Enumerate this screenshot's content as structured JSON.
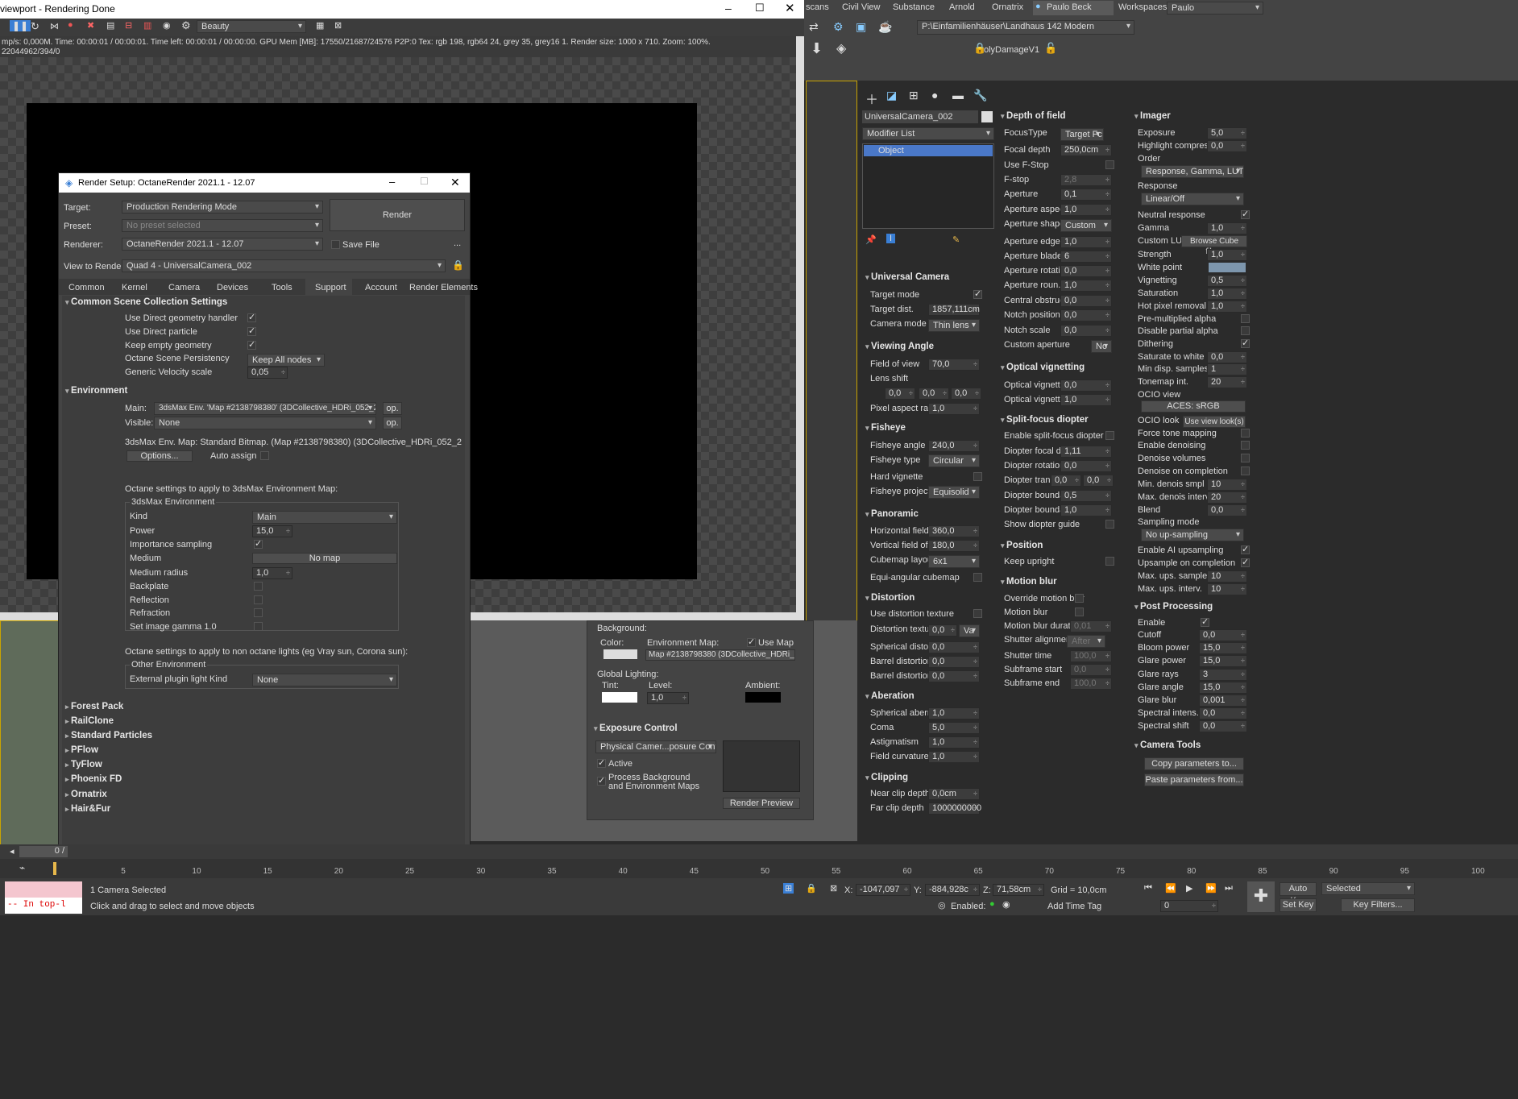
{
  "vfb": {
    "title": "viewport - Rendering Done",
    "channel": "Beauty",
    "status": "mp/s: 0,000M.   Time: 00:00:01 / 00:00:01.   Time left: 00:00:01 / 00:00:00.   GPU Mem [MB]: 17550/21687/24576 P2P:0   Tex: rgb 198, rgb64 24, grey 35, grey16 1.   Render size: 1000 x 710.   Zoom: 100%.",
    "status2": "22044962/394/0"
  },
  "topmenu": {
    "items": [
      "scans",
      "Civil View",
      "Substance",
      "Arnold",
      "Ornatrix"
    ],
    "user": "Paulo Beck",
    "workspaces_label": "Workspaces:",
    "workspace": "Paulo",
    "path": "P:\\Einfamilienhäuser\\Landhaus 142 Modern",
    "objname": "olyDamageV1"
  },
  "rs": {
    "title": "Render Setup: OctaneRender 2021.1 - 12.07",
    "target_label": "Target:",
    "target": "Production Rendering Mode",
    "preset_label": "Preset:",
    "preset": "No preset selected",
    "renderer_label": "Renderer:",
    "renderer": "OctaneRender 2021.1 - 12.07",
    "save_file": "Save File",
    "dots": "...",
    "render_btn": "Render",
    "view_label": "View to Render:",
    "view": "Quad 4 - UniversalCamera_002",
    "tabs": [
      "Common",
      "Kernel",
      "Camera",
      "Devices",
      "Tools",
      "Support",
      "Account",
      "Render Elements"
    ],
    "csc": {
      "title": "Common Scene Collection Settings",
      "rows": [
        "Use Direct geometry handler",
        "Use Direct particle",
        "Keep empty geometry",
        "Octane Scene Persistency",
        "Generic Velocity scale"
      ],
      "persist": "Keep All nodes",
      "velocity": "0,05"
    },
    "env": {
      "title": "Environment",
      "main_label": "Main:",
      "main": "3dsMax Env. 'Map #2138798380' (3DCollective_HDRi_052_2113",
      "visible_label": "Visible:",
      "visible": "None",
      "op": "op.",
      "info": "3dsMax Env. Map:  Standard Bitmap. (Map #2138798380) (3DCollective_HDRi_052_2",
      "options": "Options...",
      "auto": "Auto assign",
      "octane_text": "Octane settings to apply to 3dsMax Environment Map:",
      "group": "3dsMax Environment",
      "rows": [
        "Kind",
        "Power",
        "Importance sampling",
        "Medium",
        "Medium radius",
        "Backplate",
        "Reflection",
        "Refraction",
        "Set image gamma 1.0"
      ],
      "kind": "Main",
      "power": "15,0",
      "medium": "No map",
      "radius": "1,0",
      "nonoct_text": "Octane settings to apply to non octane lights (eg Vray sun, Corona sun):",
      "other_group": "Other Environment",
      "ext_label": "External plugin light Kind",
      "ext": "None"
    },
    "rollouts": [
      "Forest Pack",
      "RailClone",
      "Standard Particles",
      "PFlow",
      "TyFlow",
      "Phoenix FD",
      "Ornatrix",
      "Hair&Fur"
    ]
  },
  "envpanel": {
    "background": "Background:",
    "color": "Color:",
    "envmap": "Environment Map:",
    "usemap": "Use Map",
    "map": "Map #2138798380 (3DCollective_HDRi_052_",
    "global": "Global Lighting:",
    "tint": "Tint:",
    "level": "Level:",
    "level_val": "1,0",
    "ambient": "Ambient:",
    "exposure": "Exposure Control",
    "exp_type": "Physical Camer...posure Control",
    "active": "Active",
    "process": "Process Background",
    "process2": "and Environment Maps",
    "preview": "Render Preview"
  },
  "cmd": {
    "object_name": "UniversalCamera_002",
    "modlist": "Modifier List",
    "stack_item": "Object",
    "uc": {
      "title": "Universal Camera",
      "target_mode": "Target mode",
      "target_dist": "Target dist.",
      "target_dist_v": "1857,111cm",
      "cam_mode": "Camera mode",
      "cam_mode_v": "Thin lens"
    },
    "va": {
      "title": "Viewing Angle",
      "fov": "Field of view",
      "fov_v": "70,0",
      "shift": "Lens shift",
      "s1": "0,0",
      "s2": "0,0",
      "s3": "0,0",
      "par": "Pixel aspect ratio",
      "par_v": "1,0"
    },
    "fish": {
      "title": "Fisheye",
      "angle": "Fisheye angle",
      "angle_v": "240,0",
      "type": "Fisheye type",
      "type_v": "Circular",
      "hard": "Hard vignette",
      "proj": "Fisheye project...",
      "proj_v": "Equisolid"
    },
    "pano": {
      "title": "Panoramic",
      "hf": "Horizontal field ...",
      "hf_v": "360,0",
      "vf": "Vertical field of ...",
      "vf_v": "180,0",
      "cube": "Cubemap layout",
      "cube_v": "6x1",
      "equi": "Equi-angular cubemap"
    },
    "dist": {
      "title": "Distortion",
      "tex": "Use distortion texture",
      "dtex": "Distortion texture",
      "dtex_v": "0,0",
      "dtex_d": "Va",
      "sph": "Spherical distort...",
      "sph_v": "0,0",
      "bar": "Barrel distortion",
      "bar_v": "0,0",
      "bar2": "Barrel distortion...",
      "bar2_v": "0,0"
    },
    "aber": {
      "title": "Aberation",
      "sph": "Spherical aberra...",
      "sph_v": "1,0",
      "coma": "Coma",
      "coma_v": "5,0",
      "ast": "Astigmatism",
      "ast_v": "1,0",
      "fc": "Field curvature",
      "fc_v": "1,0"
    },
    "clip": {
      "title": "Clipping",
      "near": "Near clip depth",
      "near_v": "0,0cm",
      "far": "Far clip depth",
      "far_v": "1000000000"
    }
  },
  "dof": {
    "title": "Depth of field",
    "focus": "FocusType",
    "focus_v": "Target Fc",
    "fdepth": "Focal depth",
    "fdepth_v": "250,0cm",
    "fstop_use": "Use F-Stop",
    "fstop": "F-stop",
    "fstop_v": "2,8",
    "aperture": "Aperture",
    "aperture_v": "0,1",
    "aspect": "Aperture aspect...",
    "aspect_v": "1,0",
    "shape": "Aperture shape",
    "shape_v": "Custom",
    "edge": "Aperture edge",
    "edge_v": "1,0",
    "blade": "Aperture blade...",
    "blade_v": "6",
    "rot": "Aperture rotation",
    "rot_v": "0,0",
    "round": "Aperture roun...",
    "round_v": "1,0",
    "central": "Central obstruc...",
    "central_v": "0,0",
    "notchp": "Notch position",
    "notchp_v": "0,0",
    "notchs": "Notch scale",
    "notchs_v": "0,0",
    "custom": "Custom aperture",
    "custom_v": "No"
  },
  "ov": {
    "title": "Optical vignetting",
    "a": "Optical vignette...",
    "a_v": "0,0",
    "b": "Optical vignette...",
    "b_v": "1,0"
  },
  "sfd": {
    "title": "Split-focus diopter",
    "enable": "Enable split-focus diopter",
    "focal": "Diopter focal d...",
    "focal_v": "1,11",
    "rot": "Diopter rotation",
    "rot_v": "0,0",
    "tran": "Diopter tran...",
    "t1": "0,0",
    "t2": "0,0",
    "b1": "Diopter bounda...",
    "b1_v": "0,5",
    "b2": "Diopter bounda...",
    "b2_v": "1,0",
    "guide": "Show diopter guide"
  },
  "pos": {
    "title": "Position",
    "keep": "Keep upright"
  },
  "mb": {
    "title": "Motion blur",
    "ovr": "Override motion blur",
    "mb": "Motion blur",
    "dur": "Motion blur duration",
    "dur_v": "0,01",
    "shut": "Shutter alignment",
    "shut_v": "After",
    "stime": "Shutter time",
    "stime_v": "100,0",
    "sstart": "Subframe start",
    "sstart_v": "0,0",
    "send": "Subframe end",
    "send_v": "100,0"
  },
  "img": {
    "title": "Imager",
    "exposure": "Exposure",
    "exposure_v": "5,0",
    "hl": "Highlight compres...",
    "hl_v": "0,0",
    "order": "Order",
    "order_v": "Response, Gamma, LUT",
    "resp": "Response",
    "resp_v": "Linear/Off",
    "neutral": "Neutral response",
    "gamma": "Gamma",
    "gamma_v": "1,0",
    "lut": "Custom LUT",
    "lut_v": "Browse Cube file...",
    "strength": "Strength",
    "strength_v": "1,0",
    "wp": "White point",
    "vig": "Vignetting",
    "vig_v": "0,5",
    "sat": "Saturation",
    "sat_v": "1,0",
    "hot": "Hot pixel removal",
    "hot_v": "1,0",
    "prem": "Pre-multiplied alpha",
    "dpa": "Disable partial alpha",
    "dither": "Dithering",
    "stw": "Saturate to white",
    "stw_v": "0,0",
    "mds": "Min disp. samples",
    "mds_v": "1",
    "tmi": "Tonemap int.",
    "tmi_v": "20",
    "ocio": "OCIO view",
    "ocio_v": "ACES: sRGB",
    "ociolook": "OCIO look",
    "ociolook_v": "Use view look(s)",
    "ftm": "Force tone mapping",
    "den": "Enable denoising",
    "dvol": "Denoise volumes",
    "doc": "Denoise on completion",
    "mdsmp": "Min. denois smpl",
    "mdsmp_v": "10",
    "mdi": "Max. denois interv.",
    "mdi_v": "20",
    "blend": "Blend",
    "blend_v": "0,0",
    "smode": "Sampling mode",
    "smode_v": "No up-sampling",
    "ai": "Enable AI upsampling",
    "uoc": "Upsample on completion",
    "mus": "Max. ups. samples",
    "mus_v": "10",
    "mui": "Max. ups. interv.",
    "mui_v": "10"
  },
  "pp": {
    "title": "Post Processing",
    "enable": "Enable",
    "cutoff": "Cutoff",
    "cutoff_v": "0,0",
    "bloom": "Bloom power",
    "bloom_v": "15,0",
    "glare": "Glare power",
    "glare_v": "15,0",
    "rays": "Glare rays",
    "rays_v": "3",
    "gangle": "Glare angle",
    "gangle_v": "15,0",
    "gblur": "Glare blur",
    "gblur_v": "0,001",
    "si": "Spectral intens.",
    "si_v": "0,0",
    "ss": "Spectral shift",
    "ss_v": "0,0"
  },
  "ct": {
    "title": "Camera Tools",
    "copy": "Copy parameters to...",
    "paste": "Paste parameters from..."
  },
  "status": {
    "frame": "0 /",
    "ticks": [
      "5",
      "10",
      "15",
      "20",
      "25",
      "30",
      "35",
      "40",
      "45",
      "50",
      "55",
      "60",
      "65",
      "70",
      "75",
      "80",
      "85",
      "90",
      "95",
      "100"
    ],
    "maxscript": "-- In top-l",
    "sel": "1 Camera Selected",
    "hint": "Click and drag to select and move objects",
    "x": "-1047,097",
    "y": "-884,928c",
    "z": "71,58cm",
    "grid": "Grid = 10,0cm",
    "autokey": "Auto Key",
    "selected": "Selected",
    "setkey": "Set Key",
    "keyfilters": "Key Filters...",
    "enabled": "Enabled:",
    "addtag": "Add Time Tag",
    "frame_val": "0"
  }
}
